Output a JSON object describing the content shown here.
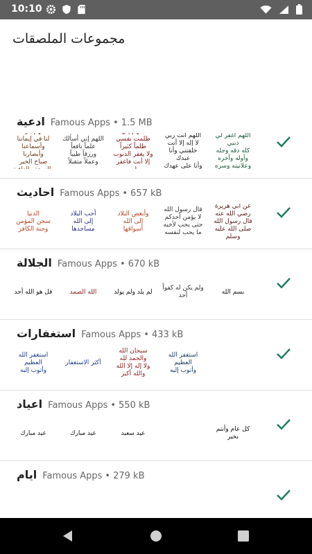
{
  "status_bar": {
    "time": "10:10",
    "left_icons": [
      "gear-icon",
      "shield-icon",
      "sd-card-icon"
    ],
    "right_icons": [
      "wifi-icon",
      "signal-icon",
      "battery-icon"
    ]
  },
  "app_bar": {
    "title": "مجموعات الملصقات"
  },
  "colors": {
    "accent": "#1a7a5e",
    "status_bar": "#5f5f5f",
    "nav_bar": "#000000"
  },
  "packs": [
    {
      "name": "ادعية",
      "publisher": "Famous Apps",
      "separator": "•",
      "size": "1.5 MB",
      "stickers": [
        {
          "lines": [
            "اللهم بارك",
            "لنا في إيماننا",
            "وأسماعنا وأبصارنا",
            "صباح الخير",
            "والصحة والعافية"
          ],
          "color": "#6b3a1a"
        },
        {
          "lines": [
            "اللهم إني أسألك",
            "علماً نافعاً",
            "ورزقاً طيباً",
            "وعملاً متقبلاً"
          ],
          "color": "#333333"
        },
        {
          "lines": [
            "اللهم إني ظلمت نفسي",
            "ظلماً كثيراً",
            "ولا يغفر الذنوب",
            "إلا أنت فاغفر لي"
          ],
          "color": "#7a1a1a"
        },
        {
          "lines": [
            "اللهم أنت ربي",
            "لا إله إلا أنت",
            "خلقتني وأنا عبدك",
            "وأنا على عهدك"
          ],
          "color": "#222222"
        },
        {
          "lines": [
            "اللهم اغفر لي ذنبي",
            "كله دقه وجله",
            "وأوله وآخره",
            "وعلانيته وسره"
          ],
          "color": "#1a5a3a"
        }
      ]
    },
    {
      "name": "احاديث",
      "publisher": "Famous Apps",
      "separator": "•",
      "size": "657 kB",
      "stickers": [
        {
          "lines": [
            "الدنيا",
            "سجن المؤمن",
            "وجنة الكافر"
          ],
          "color": "#b5421a"
        },
        {
          "lines": [
            "أحب البلاد",
            "إلى الله",
            "مساجدها"
          ],
          "color": "#2a2a8a"
        },
        {
          "lines": [
            "وأبغض البلاد",
            "إلى الله",
            "أسواقها"
          ],
          "color": "#b5421a"
        },
        {
          "lines": [
            "قال رسول الله",
            "لا يؤمن أحدكم",
            "حتى يحب لأخيه",
            "ما يحب لنفسه"
          ],
          "color": "#333333"
        },
        {
          "lines": [
            "عن أبي هريرة",
            "رضي الله عنه",
            "قال رسول الله",
            "صلى الله عليه وسلم"
          ],
          "color": "#5a1a1a"
        }
      ]
    },
    {
      "name": "الجلالة",
      "publisher": "Famous Apps",
      "separator": "•",
      "size": "670 kB",
      "stickers": [
        {
          "lines": [
            "قل هو الله أحد"
          ],
          "color": "#111111"
        },
        {
          "lines": [
            "الله الصمد"
          ],
          "color": "#8a1a1a"
        },
        {
          "lines": [
            "لم يلد ولم يولد"
          ],
          "color": "#111111"
        },
        {
          "lines": [
            "ولم يكن له كفواً أحد"
          ],
          "color": "#333333"
        },
        {
          "lines": [
            "بسم الله"
          ],
          "color": "#111111"
        }
      ]
    },
    {
      "name": "استغفارات",
      "publisher": "Famous Apps",
      "separator": "•",
      "size": "433 kB",
      "stickers": [
        {
          "lines": [
            "استغفر الله العظيم",
            "وأتوب إليه"
          ],
          "color": "#1a3a8a"
        },
        {
          "lines": [
            "أكثر الاستغفار"
          ],
          "color": "#1a3a8a"
        },
        {
          "lines": [
            "سبحان الله والحمد لله",
            "ولا إله إلا الله",
            "والله أكبر"
          ],
          "color": "#8a1a1a"
        },
        {
          "lines": [
            "استغفر الله",
            "العظيم",
            "وأتوب إليه"
          ],
          "color": "#1a3a5a"
        }
      ]
    },
    {
      "name": "اعياد",
      "publisher": "Famous Apps",
      "separator": "•",
      "size": "550 kB",
      "stickers": [
        {
          "lines": [
            "عيد مبارك"
          ],
          "color": "#111111"
        },
        {
          "lines": [
            "عيد مبارك"
          ],
          "color": "#111111"
        },
        {
          "lines": [
            "عيد سعيد"
          ],
          "color": "#111111"
        },
        {
          "lines": [
            ""
          ],
          "color": "#111111"
        },
        {
          "lines": [
            "كل عام وأنتم بخير"
          ],
          "color": "#111111"
        }
      ]
    },
    {
      "name": "ايام",
      "publisher": "Famous Apps",
      "separator": "•",
      "size": "279 kB",
      "stickers": []
    }
  ],
  "nav_bar": {
    "buttons": [
      "back-icon",
      "home-icon",
      "recents-icon"
    ]
  }
}
